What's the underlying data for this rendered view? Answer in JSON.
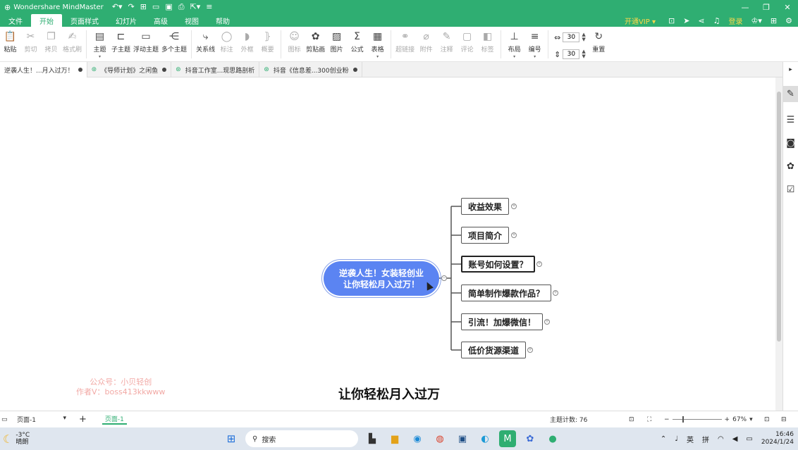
{
  "app": {
    "title": "Wondershare MindMaster",
    "quick_icons": [
      "undo-icon",
      "redo-icon",
      "new-icon",
      "open-icon",
      "save-icon",
      "print-icon",
      "export-icon"
    ]
  },
  "menu": {
    "tabs": [
      "文件",
      "开始",
      "页面样式",
      "幻灯片",
      "高级",
      "视图",
      "帮助"
    ],
    "active": "开始",
    "vip": "开通VIP",
    "login": "登录"
  },
  "ribbon": {
    "groups": [
      [
        {
          "label": "粘贴",
          "icon": "paste-icon",
          "dim": false
        },
        {
          "label": "剪切",
          "icon": "cut-icon",
          "dim": true
        },
        {
          "label": "拷贝",
          "icon": "copy-icon",
          "dim": true
        },
        {
          "label": "格式刷",
          "icon": "format-brush-icon",
          "dim": true
        }
      ],
      [
        {
          "label": "主题",
          "icon": "topic-icon",
          "dim": false,
          "dd": true
        },
        {
          "label": "子主题",
          "icon": "subtopic-icon",
          "dim": false
        },
        {
          "label": "浮动主题",
          "icon": "floating-topic-icon",
          "dim": false
        },
        {
          "label": "多个主题",
          "icon": "multi-topic-icon",
          "dim": false
        }
      ],
      [
        {
          "label": "关系线",
          "icon": "relation-icon",
          "dim": false
        },
        {
          "label": "标注",
          "icon": "callout-icon",
          "dim": true
        },
        {
          "label": "外框",
          "icon": "boundary-icon",
          "dim": true
        },
        {
          "label": "概要",
          "icon": "summary-icon",
          "dim": true
        }
      ],
      [
        {
          "label": "图标",
          "icon": "mark-icon",
          "dim": true
        },
        {
          "label": "剪贴画",
          "icon": "clipart-icon",
          "dim": false
        },
        {
          "label": "图片",
          "icon": "image-icon",
          "dim": false
        },
        {
          "label": "公式",
          "icon": "formula-icon",
          "dim": false
        },
        {
          "label": "表格",
          "icon": "table-icon",
          "dim": false,
          "dd": true
        }
      ],
      [
        {
          "label": "超链接",
          "icon": "link-icon",
          "dim": true
        },
        {
          "label": "附件",
          "icon": "attachment-icon",
          "dim": true
        },
        {
          "label": "注释",
          "icon": "note-icon",
          "dim": true
        },
        {
          "label": "评论",
          "icon": "comment-icon",
          "dim": true
        },
        {
          "label": "标签",
          "icon": "tag-icon",
          "dim": true
        }
      ],
      [
        {
          "label": "布局",
          "icon": "layout-icon",
          "dim": false,
          "dd": true
        },
        {
          "label": "编号",
          "icon": "numbering-icon",
          "dim": false,
          "dd": true
        }
      ]
    ],
    "spacing_h": "30",
    "spacing_v": "30",
    "reset": "重置"
  },
  "doctabs": [
    {
      "label": "逆袭人生！...月入过万！",
      "active": true,
      "dot": true
    },
    {
      "label": "《导师计划》之闲鱼",
      "active": false,
      "dot": true
    },
    {
      "label": "抖音工作室...现思路剖析",
      "active": false,
      "dot": false
    },
    {
      "label": "抖音《信息差...300创业粉",
      "active": false,
      "dot": true
    }
  ],
  "mindmap": {
    "central_line1": "逆袭人生！女装轻创业",
    "central_line2": "让你轻松月入过万！",
    "branches": [
      "收益效果",
      "项目简介",
      "账号如何设置？",
      "简单制作爆款作品？",
      "引流！加爆微信！",
      "低价货源渠道"
    ]
  },
  "watermark": {
    "line1": "公众号：小贝轻创",
    "line2": "作者V：boss413kkwww"
  },
  "subtitle": "让你轻松月入过万",
  "status": {
    "page_select": "页面-1",
    "page_tab": "页面-1",
    "topic_count_label": "主题计数:",
    "topic_count": "76",
    "zoom": "67%"
  },
  "taskbar": {
    "temp": "-3°C",
    "weather": "晴朗",
    "search": "搜索",
    "lang": "英",
    "ime": "拼",
    "time": "16:46",
    "date": "2024/1/24"
  }
}
